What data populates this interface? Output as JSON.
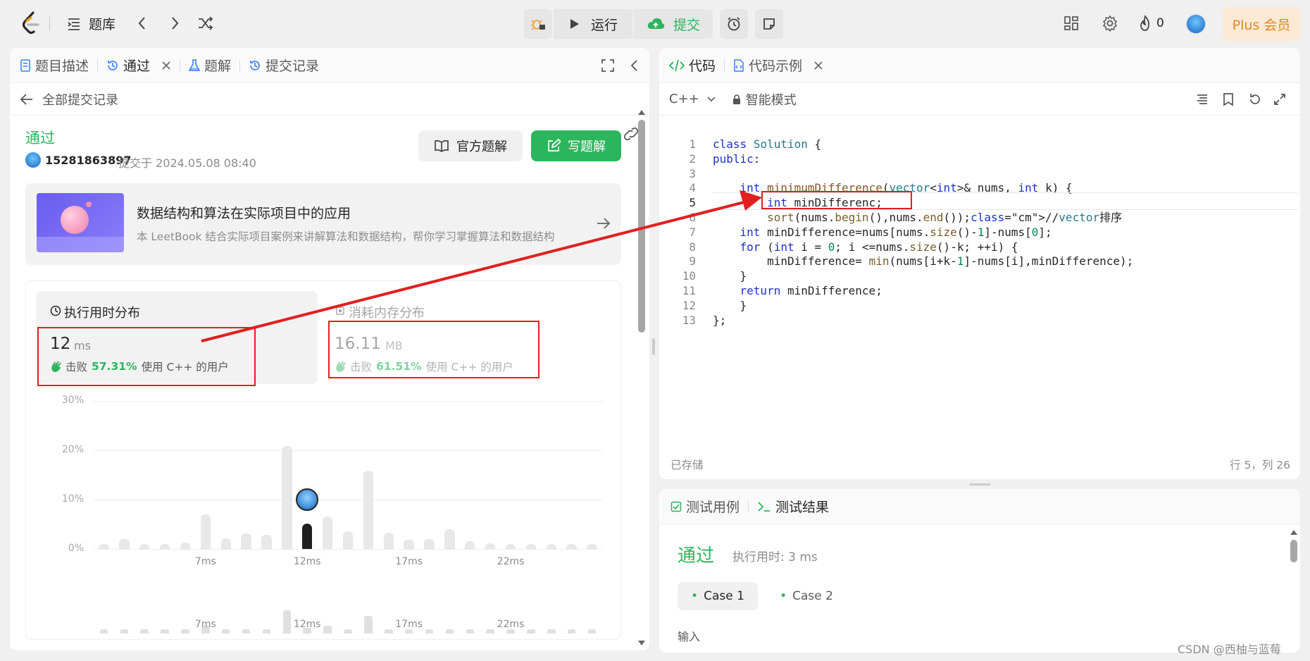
{
  "topbar": {
    "problem_bank": "题库",
    "run": "运行",
    "submit": "提交",
    "streak": "0",
    "plus": "Plus 会员"
  },
  "left_panel": {
    "tabs": [
      {
        "label": "题目描述"
      },
      {
        "label": "通过"
      },
      {
        "label": "题解"
      },
      {
        "label": "提交记录"
      }
    ],
    "back_label": "全部提交记录",
    "status": "通过",
    "user": "15281863897",
    "submitted_at": "提交于 2024.05.08 08:40",
    "official_solution": "官方题解",
    "write_solution": "写题解",
    "book": {
      "title": "数据结构和算法在实际项目中的应用",
      "desc": "本 LeetBook 结合实际项目案例来讲解算法和数据结构，帮你学习掌握算法和数据结构"
    },
    "runtime": {
      "title": "执行用时分布",
      "value": "12",
      "unit": "ms",
      "beats_prefix": "击败",
      "beats_pct": "57.31%",
      "beats_suffix": "使用 C++ 的用户"
    },
    "memory": {
      "title": "消耗内存分布",
      "value": "16.11",
      "unit": "MB",
      "beats_prefix": "击败",
      "beats_pct": "61.51%",
      "beats_suffix": "使用 C++ 的用户"
    }
  },
  "chart_data": {
    "type": "bar",
    "y_ticks": [
      "30%",
      "20%",
      "10%",
      "0%"
    ],
    "x_ticks": [
      "7ms",
      "12ms",
      "17ms",
      "22ms"
    ],
    "ylim": [
      0,
      30
    ],
    "values": [
      1,
      2,
      1,
      1,
      1.3,
      7,
      2.2,
      3.2,
      2.8,
      20.8,
      5.2,
      6.6,
      3.6,
      15.9,
      3.3,
      1.8,
      2,
      4,
      1.6,
      1.1,
      1,
      1,
      1,
      1,
      1
    ],
    "highlight_index": 10,
    "grid": true
  },
  "right_panel": {
    "tabs": [
      {
        "label": "代码"
      },
      {
        "label": "代码示例"
      }
    ],
    "language": "C++",
    "mode": "智能模式",
    "saved": "已存储",
    "cursor": "行 5，列 26",
    "code_lines": [
      "class Solution {",
      "public:",
      "",
      "    int minimumDifference(vector<int>& nums, int k) {",
      "        int minDifferenc;",
      "        sort(nums.begin(),nums.end());//vector排序",
      "    int minDifference=nums[nums.size()-1]-nums[0];",
      "    for (int i = 0; i <=nums.size()-k; ++i) {",
      "        minDifference= min(nums[i+k-1]-nums[i],minDifference);",
      "    }",
      "    return minDifference;",
      "    }",
      "};"
    ]
  },
  "test_panel": {
    "tabs": [
      {
        "label": "测试用例"
      },
      {
        "label": "测试结果"
      }
    ],
    "status": "通过",
    "runtime": "执行用时: 3 ms",
    "cases": [
      "Case 1",
      "Case 2"
    ],
    "input_label": "输入"
  },
  "watermark": "CSDN @西柚与蓝莓"
}
